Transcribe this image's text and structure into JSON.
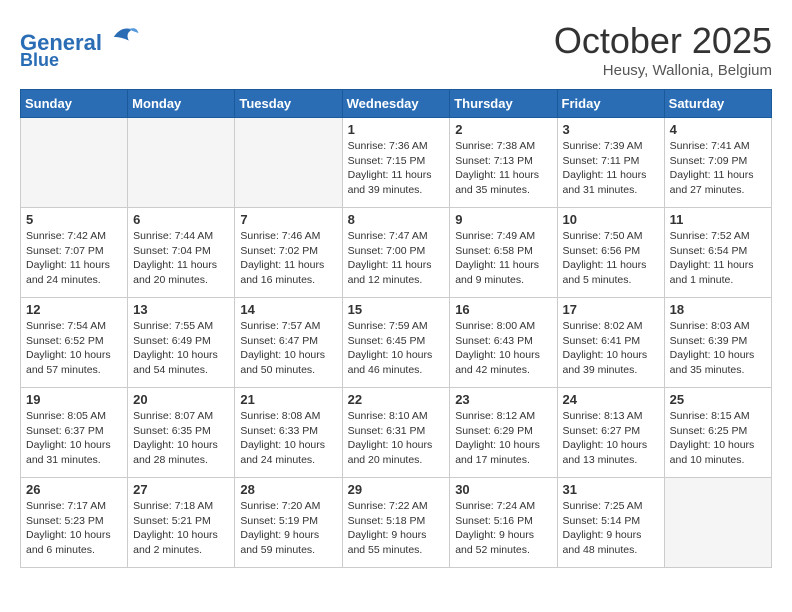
{
  "header": {
    "logo_line1": "General",
    "logo_line2": "Blue",
    "month": "October 2025",
    "location": "Heusy, Wallonia, Belgium"
  },
  "weekdays": [
    "Sunday",
    "Monday",
    "Tuesday",
    "Wednesday",
    "Thursday",
    "Friday",
    "Saturday"
  ],
  "weeks": [
    [
      {
        "day": "",
        "sunrise": "",
        "sunset": "",
        "daylight": ""
      },
      {
        "day": "",
        "sunrise": "",
        "sunset": "",
        "daylight": ""
      },
      {
        "day": "",
        "sunrise": "",
        "sunset": "",
        "daylight": ""
      },
      {
        "day": "1",
        "sunrise": "Sunrise: 7:36 AM",
        "sunset": "Sunset: 7:15 PM",
        "daylight": "Daylight: 11 hours and 39 minutes."
      },
      {
        "day": "2",
        "sunrise": "Sunrise: 7:38 AM",
        "sunset": "Sunset: 7:13 PM",
        "daylight": "Daylight: 11 hours and 35 minutes."
      },
      {
        "day": "3",
        "sunrise": "Sunrise: 7:39 AM",
        "sunset": "Sunset: 7:11 PM",
        "daylight": "Daylight: 11 hours and 31 minutes."
      },
      {
        "day": "4",
        "sunrise": "Sunrise: 7:41 AM",
        "sunset": "Sunset: 7:09 PM",
        "daylight": "Daylight: 11 hours and 27 minutes."
      }
    ],
    [
      {
        "day": "5",
        "sunrise": "Sunrise: 7:42 AM",
        "sunset": "Sunset: 7:07 PM",
        "daylight": "Daylight: 11 hours and 24 minutes."
      },
      {
        "day": "6",
        "sunrise": "Sunrise: 7:44 AM",
        "sunset": "Sunset: 7:04 PM",
        "daylight": "Daylight: 11 hours and 20 minutes."
      },
      {
        "day": "7",
        "sunrise": "Sunrise: 7:46 AM",
        "sunset": "Sunset: 7:02 PM",
        "daylight": "Daylight: 11 hours and 16 minutes."
      },
      {
        "day": "8",
        "sunrise": "Sunrise: 7:47 AM",
        "sunset": "Sunset: 7:00 PM",
        "daylight": "Daylight: 11 hours and 12 minutes."
      },
      {
        "day": "9",
        "sunrise": "Sunrise: 7:49 AM",
        "sunset": "Sunset: 6:58 PM",
        "daylight": "Daylight: 11 hours and 9 minutes."
      },
      {
        "day": "10",
        "sunrise": "Sunrise: 7:50 AM",
        "sunset": "Sunset: 6:56 PM",
        "daylight": "Daylight: 11 hours and 5 minutes."
      },
      {
        "day": "11",
        "sunrise": "Sunrise: 7:52 AM",
        "sunset": "Sunset: 6:54 PM",
        "daylight": "Daylight: 11 hours and 1 minute."
      }
    ],
    [
      {
        "day": "12",
        "sunrise": "Sunrise: 7:54 AM",
        "sunset": "Sunset: 6:52 PM",
        "daylight": "Daylight: 10 hours and 57 minutes."
      },
      {
        "day": "13",
        "sunrise": "Sunrise: 7:55 AM",
        "sunset": "Sunset: 6:49 PM",
        "daylight": "Daylight: 10 hours and 54 minutes."
      },
      {
        "day": "14",
        "sunrise": "Sunrise: 7:57 AM",
        "sunset": "Sunset: 6:47 PM",
        "daylight": "Daylight: 10 hours and 50 minutes."
      },
      {
        "day": "15",
        "sunrise": "Sunrise: 7:59 AM",
        "sunset": "Sunset: 6:45 PM",
        "daylight": "Daylight: 10 hours and 46 minutes."
      },
      {
        "day": "16",
        "sunrise": "Sunrise: 8:00 AM",
        "sunset": "Sunset: 6:43 PM",
        "daylight": "Daylight: 10 hours and 42 minutes."
      },
      {
        "day": "17",
        "sunrise": "Sunrise: 8:02 AM",
        "sunset": "Sunset: 6:41 PM",
        "daylight": "Daylight: 10 hours and 39 minutes."
      },
      {
        "day": "18",
        "sunrise": "Sunrise: 8:03 AM",
        "sunset": "Sunset: 6:39 PM",
        "daylight": "Daylight: 10 hours and 35 minutes."
      }
    ],
    [
      {
        "day": "19",
        "sunrise": "Sunrise: 8:05 AM",
        "sunset": "Sunset: 6:37 PM",
        "daylight": "Daylight: 10 hours and 31 minutes."
      },
      {
        "day": "20",
        "sunrise": "Sunrise: 8:07 AM",
        "sunset": "Sunset: 6:35 PM",
        "daylight": "Daylight: 10 hours and 28 minutes."
      },
      {
        "day": "21",
        "sunrise": "Sunrise: 8:08 AM",
        "sunset": "Sunset: 6:33 PM",
        "daylight": "Daylight: 10 hours and 24 minutes."
      },
      {
        "day": "22",
        "sunrise": "Sunrise: 8:10 AM",
        "sunset": "Sunset: 6:31 PM",
        "daylight": "Daylight: 10 hours and 20 minutes."
      },
      {
        "day": "23",
        "sunrise": "Sunrise: 8:12 AM",
        "sunset": "Sunset: 6:29 PM",
        "daylight": "Daylight: 10 hours and 17 minutes."
      },
      {
        "day": "24",
        "sunrise": "Sunrise: 8:13 AM",
        "sunset": "Sunset: 6:27 PM",
        "daylight": "Daylight: 10 hours and 13 minutes."
      },
      {
        "day": "25",
        "sunrise": "Sunrise: 8:15 AM",
        "sunset": "Sunset: 6:25 PM",
        "daylight": "Daylight: 10 hours and 10 minutes."
      }
    ],
    [
      {
        "day": "26",
        "sunrise": "Sunrise: 7:17 AM",
        "sunset": "Sunset: 5:23 PM",
        "daylight": "Daylight: 10 hours and 6 minutes."
      },
      {
        "day": "27",
        "sunrise": "Sunrise: 7:18 AM",
        "sunset": "Sunset: 5:21 PM",
        "daylight": "Daylight: 10 hours and 2 minutes."
      },
      {
        "day": "28",
        "sunrise": "Sunrise: 7:20 AM",
        "sunset": "Sunset: 5:19 PM",
        "daylight": "Daylight: 9 hours and 59 minutes."
      },
      {
        "day": "29",
        "sunrise": "Sunrise: 7:22 AM",
        "sunset": "Sunset: 5:18 PM",
        "daylight": "Daylight: 9 hours and 55 minutes."
      },
      {
        "day": "30",
        "sunrise": "Sunrise: 7:24 AM",
        "sunset": "Sunset: 5:16 PM",
        "daylight": "Daylight: 9 hours and 52 minutes."
      },
      {
        "day": "31",
        "sunrise": "Sunrise: 7:25 AM",
        "sunset": "Sunset: 5:14 PM",
        "daylight": "Daylight: 9 hours and 48 minutes."
      },
      {
        "day": "",
        "sunrise": "",
        "sunset": "",
        "daylight": ""
      }
    ]
  ]
}
